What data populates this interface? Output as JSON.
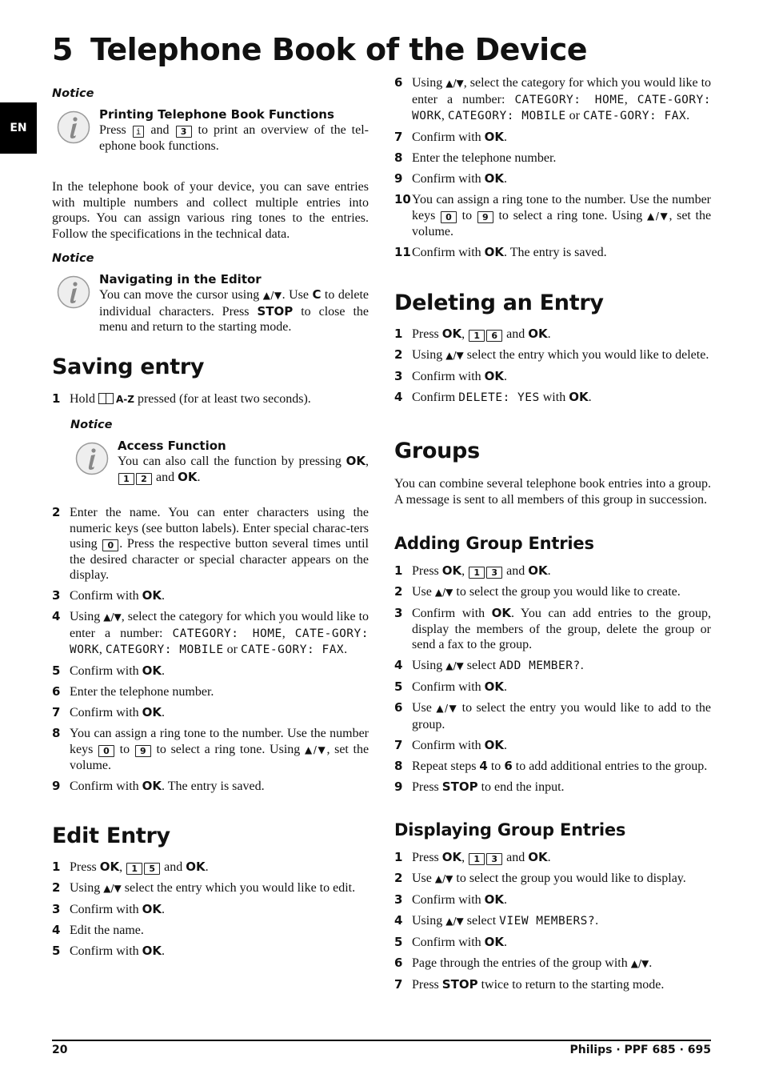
{
  "chapter": {
    "number": "5",
    "title": "Telephone Book of the Device"
  },
  "language_tab": "EN",
  "icons": {
    "info": "info-icon",
    "book": "phonebook-icon",
    "nav_arrows": "up-down-arrows-icon"
  },
  "notice1": {
    "label": "Notice",
    "title": "Printing Telephone Book Functions",
    "text_a": "Press",
    "key_a": "i",
    "text_b": "and",
    "key_b": "3",
    "text_c": "to print an overview of the tel-ephone book functions."
  },
  "intro": "In the telephone book of your device, you can save entries with multiple numbers and collect multiple entries into groups. You can assign various ring tones to the entries. Follow the specifications in the technical data.",
  "notice2": {
    "label": "Notice",
    "title": "Navigating in the Editor",
    "text_a": "You can move the cursor using",
    "arrows": "▲/▼",
    "text_b": ". Use",
    "key_c": "C",
    "text_c": "to delete individual characters. Press",
    "key_stop": "STOP",
    "text_d": "to close the menu and return to the starting mode."
  },
  "saving": {
    "title": "Saving entry",
    "step1": {
      "n": "1",
      "a": "Hold",
      "az": "A-Z",
      "b": "pressed (for at least two seconds)."
    },
    "notice": {
      "label": "Notice",
      "title": "Access Function",
      "text_a": "You can also call the function by pressing",
      "ok": "OK",
      "key1": "1",
      "key2": "2",
      "and": "and"
    },
    "step2": {
      "n": "2",
      "a": "Enter the name. You can enter characters using the numeric keys (see button labels).  Enter special charac-ters using",
      "key": "0",
      "b": ". Press the respective button several times until the desired character or special character appears on the display."
    },
    "step3": {
      "n": "3",
      "a": "Confirm with",
      "ok": "OK"
    },
    "step4": {
      "n": "4",
      "a": "Using",
      "arrows": "▲/▼",
      "b": ", select the category for which you would like to enter a number:",
      "c1": "CATEGORY: HOME",
      "c2": "CATE-GORY: WORK",
      "c3": "CATEGORY: MOBILE",
      "or": "or",
      "c4": "CATE-GORY: FAX"
    },
    "step5": {
      "n": "5",
      "a": "Confirm with",
      "ok": "OK"
    },
    "step6": {
      "n": "6",
      "a": "Enter the telephone number."
    },
    "step7": {
      "n": "7",
      "a": "Confirm with",
      "ok": "OK"
    },
    "step8": {
      "n": "8",
      "a": "You can assign a ring tone to the number. Use the number keys",
      "k0": "0",
      "to": "to",
      "k9": "9",
      "b": "to select a ring tone. Using",
      "arrows": "▲/▼",
      "c": ", set the volume."
    },
    "step9": {
      "n": "9",
      "a": "Confirm with",
      "ok": "OK",
      "b": ". The entry is saved."
    }
  },
  "edit": {
    "title": "Edit Entry",
    "step1": {
      "n": "1",
      "a": "Press",
      "ok": "OK",
      "k1": "1",
      "k2": "5",
      "and": "and"
    },
    "step2": {
      "n": "2",
      "a": "Using",
      "arrows": "▲/▼",
      "b": "select the entry which you would like to edit."
    },
    "step3": {
      "n": "3",
      "a": "Confirm with",
      "ok": "OK"
    },
    "step4": {
      "n": "4",
      "a": "Edit the name."
    },
    "step5": {
      "n": "5",
      "a": "Confirm with",
      "ok": "OK"
    },
    "step6": {
      "n": "6",
      "a": "Using",
      "arrows": "▲/▼",
      "b": ", select the category for which you would like to enter a number:",
      "c1": "CATEGORY: HOME",
      "c2": "CATE-GORY: WORK",
      "c3": "CATEGORY: MOBILE",
      "or": "or",
      "c4": "CATE-GORY: FAX"
    },
    "step7": {
      "n": "7",
      "a": "Confirm with",
      "ok": "OK"
    },
    "step8": {
      "n": "8",
      "a": "Enter the telephone number."
    },
    "step9": {
      "n": "9",
      "a": "Confirm with",
      "ok": "OK"
    },
    "step10": {
      "n": "10",
      "a": "You can assign a ring tone to the number. Use the number keys",
      "k0": "0",
      "to": "to",
      "k9": "9",
      "b": "to select a ring tone. Using",
      "arrows": "▲/▼",
      "c": ", set the volume."
    },
    "step11": {
      "n": "11",
      "a": "Confirm with",
      "ok": "OK",
      "b": ". The entry is saved."
    }
  },
  "delete": {
    "title": "Deleting an Entry",
    "step1": {
      "n": "1",
      "a": "Press",
      "ok": "OK",
      "k1": "1",
      "k2": "6",
      "and": "and"
    },
    "step2": {
      "n": "2",
      "a": "Using",
      "arrows": "▲/▼",
      "b": "select the entry which you would like to delete."
    },
    "step3": {
      "n": "3",
      "a": "Confirm with",
      "ok": "OK"
    },
    "step4": {
      "n": "4",
      "a": "Confirm",
      "display": "DELETE: YES",
      "b": "with",
      "ok": "OK"
    }
  },
  "groups": {
    "title": "Groups",
    "intro": "You can combine several telephone book entries into a group. A message is sent to all members of this group in succession.",
    "adding": {
      "title": "Adding Group Entries",
      "step1": {
        "n": "1",
        "a": "Press",
        "ok": "OK",
        "k1": "1",
        "k2": "3",
        "and": "and"
      },
      "step2": {
        "n": "2",
        "a": "Use",
        "arrows": "▲/▼",
        "b": "to select the group you would like to create."
      },
      "step3": {
        "n": "3",
        "a": "Confirm with",
        "ok": "OK",
        "b": ". You can add entries to the group, display the members of the group, delete the group or send a fax to the group."
      },
      "step4": {
        "n": "4",
        "a": "Using",
        "arrows": "▲/▼",
        "b": "select",
        "display": "ADD MEMBER?"
      },
      "step5": {
        "n": "5",
        "a": "Confirm with",
        "ok": "OK"
      },
      "step6": {
        "n": "6",
        "a": "Use",
        "arrows": "▲/▼",
        "b": "to select the entry you would like to add to the group."
      },
      "step7": {
        "n": "7",
        "a": "Confirm with",
        "ok": "OK"
      },
      "step8": {
        "n": "8",
        "a": "Repeat steps",
        "s4": "4",
        "to": "to",
        "s6": "6",
        "b": "to add additional entries to the group."
      },
      "step9": {
        "n": "9",
        "a": "Press",
        "stop": "STOP",
        "b": "to end the input."
      }
    },
    "displaying": {
      "title": "Displaying Group Entries",
      "step1": {
        "n": "1",
        "a": "Press",
        "ok": "OK",
        "k1": "1",
        "k2": "3",
        "and": "and"
      },
      "step2": {
        "n": "2",
        "a": "Use",
        "arrows": "▲/▼",
        "b": "to select the group you would like to display."
      },
      "step3": {
        "n": "3",
        "a": "Confirm with",
        "ok": "OK"
      },
      "step4": {
        "n": "4",
        "a": "Using",
        "arrows": "▲/▼",
        "b": "select",
        "display": "VIEW MEMBERS?"
      },
      "step5": {
        "n": "5",
        "a": "Confirm with",
        "ok": "OK"
      },
      "step6": {
        "n": "6",
        "a": "Page through the entries of the group with",
        "arrows": "▲/▼"
      },
      "step7": {
        "n": "7",
        "a": "Press",
        "stop": "STOP",
        "b": "twice to return to the starting mode."
      }
    }
  },
  "footer": {
    "page": "20",
    "product": "Philips · PPF 685 · 695"
  }
}
